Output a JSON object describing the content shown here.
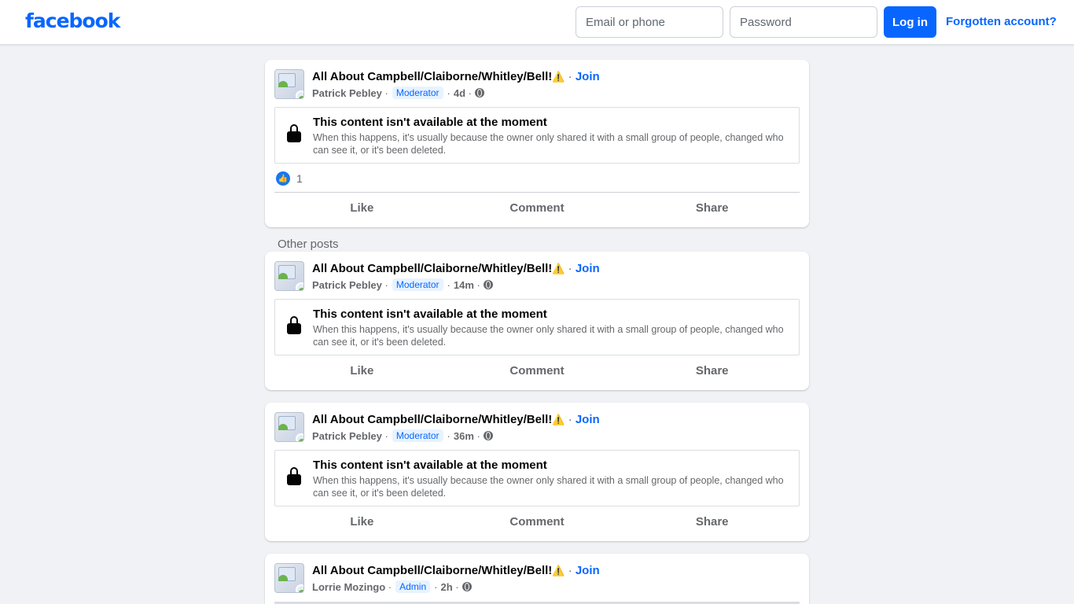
{
  "header": {
    "logo": "facebook",
    "email_placeholder": "Email or phone",
    "password_placeholder": "Password",
    "login_label": "Log in",
    "forgot_label": "Forgotten account?"
  },
  "feed": {
    "other_posts_label": "Other posts",
    "posts": [
      {
        "group": "All About Campbell/Claiborne/Whitley/Bell!",
        "warning_icon": "⚠️",
        "join_label": "Join",
        "author": "Patrick Pebley",
        "role": "Moderator",
        "time": "4d",
        "notice_title": "This content isn't available at the moment",
        "notice_text": "When this happens, it's usually because the owner only shared it with a small group of people, changed who can see it, or it's been deleted.",
        "reaction_count": "1",
        "actions": [
          "Like",
          "Comment",
          "Share"
        ]
      },
      {
        "group": "All About Campbell/Claiborne/Whitley/Bell!",
        "warning_icon": "⚠️",
        "join_label": "Join",
        "author": "Patrick Pebley",
        "role": "Moderator",
        "time": "14m",
        "notice_title": "This content isn't available at the moment",
        "notice_text": "When this happens, it's usually because the owner only shared it with a small group of people, changed who can see it, or it's been deleted.",
        "actions": [
          "Like",
          "Comment",
          "Share"
        ]
      },
      {
        "group": "All About Campbell/Claiborne/Whitley/Bell!",
        "warning_icon": "⚠️",
        "join_label": "Join",
        "author": "Patrick Pebley",
        "role": "Moderator",
        "time": "36m",
        "notice_title": "This content isn't available at the moment",
        "notice_text": "When this happens, it's usually because the owner only shared it with a small group of people, changed who can see it, or it's been deleted.",
        "actions": [
          "Like",
          "Comment",
          "Share"
        ]
      },
      {
        "group": "All About Campbell/Claiborne/Whitley/Bell!",
        "warning_icon": "⚠️",
        "join_label": "Join",
        "author": "Lorrie Mozingo",
        "role": "Admin",
        "time": "2h"
      }
    ]
  },
  "colors": {
    "brand": "#0866ff",
    "background": "#f0f2f5",
    "secondary_text": "#65676b"
  }
}
